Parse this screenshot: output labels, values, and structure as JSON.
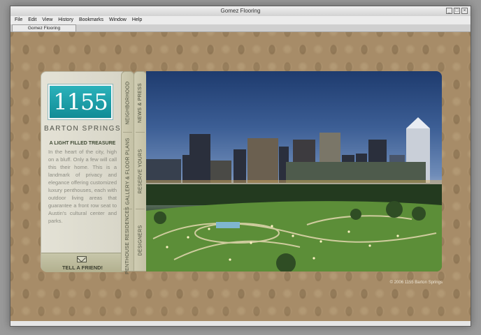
{
  "window": {
    "title": "Gomez Flooring",
    "controls": [
      "_",
      "□",
      "×"
    ]
  },
  "menu": [
    "File",
    "Edit",
    "View",
    "History",
    "Bookmarks",
    "Window",
    "Help"
  ],
  "tab": {
    "label": "Gomez Flooring"
  },
  "site": {
    "logo_number": "1155",
    "logo_sub": "BARTON SPRINGS",
    "tagline": "A LIGHT FILLED TREASURE",
    "body": "In the heart of the city, high on a bluff. Only a few will call this their home. This is a landmark of privacy and elegance offering customized luxury penthouses, each with outdoor living areas that guarantee a front row seat to Austin's cultural center and parks.",
    "tell_friend": "TELL A FRIEND!",
    "nav_strip_1": [
      "NEIGHBORHOOD",
      "GALLERY & FLOOR PLANS",
      "PENTHOUSE RESIDENCES"
    ],
    "nav_strip_2": [
      "NEWS & PRESS",
      "RESERVE YOURS",
      "DESIGNERS"
    ],
    "photo_icon": "city-skyline-photo",
    "envelope_icon": "envelope-icon",
    "copyright": "© 2006 1155 Barton Springs"
  },
  "colors": {
    "wallpaper": "#a78c68",
    "logo_teal": "#1a9ea8",
    "panel": "#e2e0d4",
    "nav": "#c9c6aa"
  }
}
